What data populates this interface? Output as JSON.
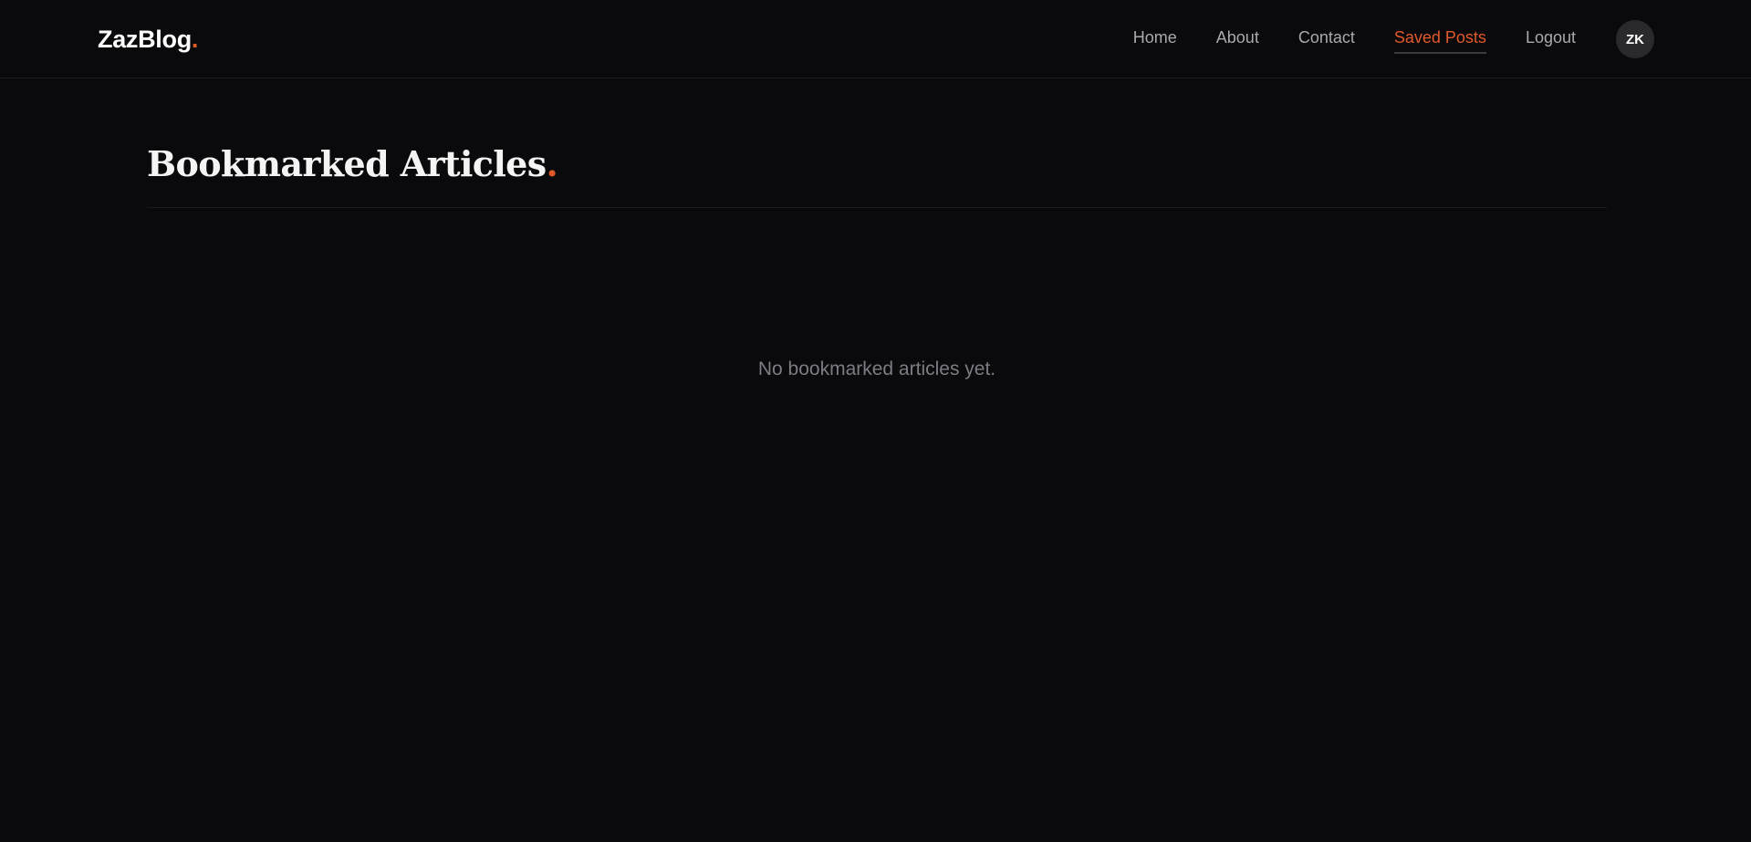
{
  "header": {
    "brand": "ZazBlog",
    "brand_dot": ".",
    "nav": {
      "home": "Home",
      "about": "About",
      "contact": "Contact",
      "saved_posts": "Saved Posts",
      "logout": "Logout"
    },
    "avatar_initials": "ZK"
  },
  "main": {
    "title": "Bookmarked Articles",
    "title_dot": ".",
    "empty_message": "No bookmarked articles yet."
  },
  "colors": {
    "accent": "#e0592a",
    "background": "#0a0a0c"
  }
}
